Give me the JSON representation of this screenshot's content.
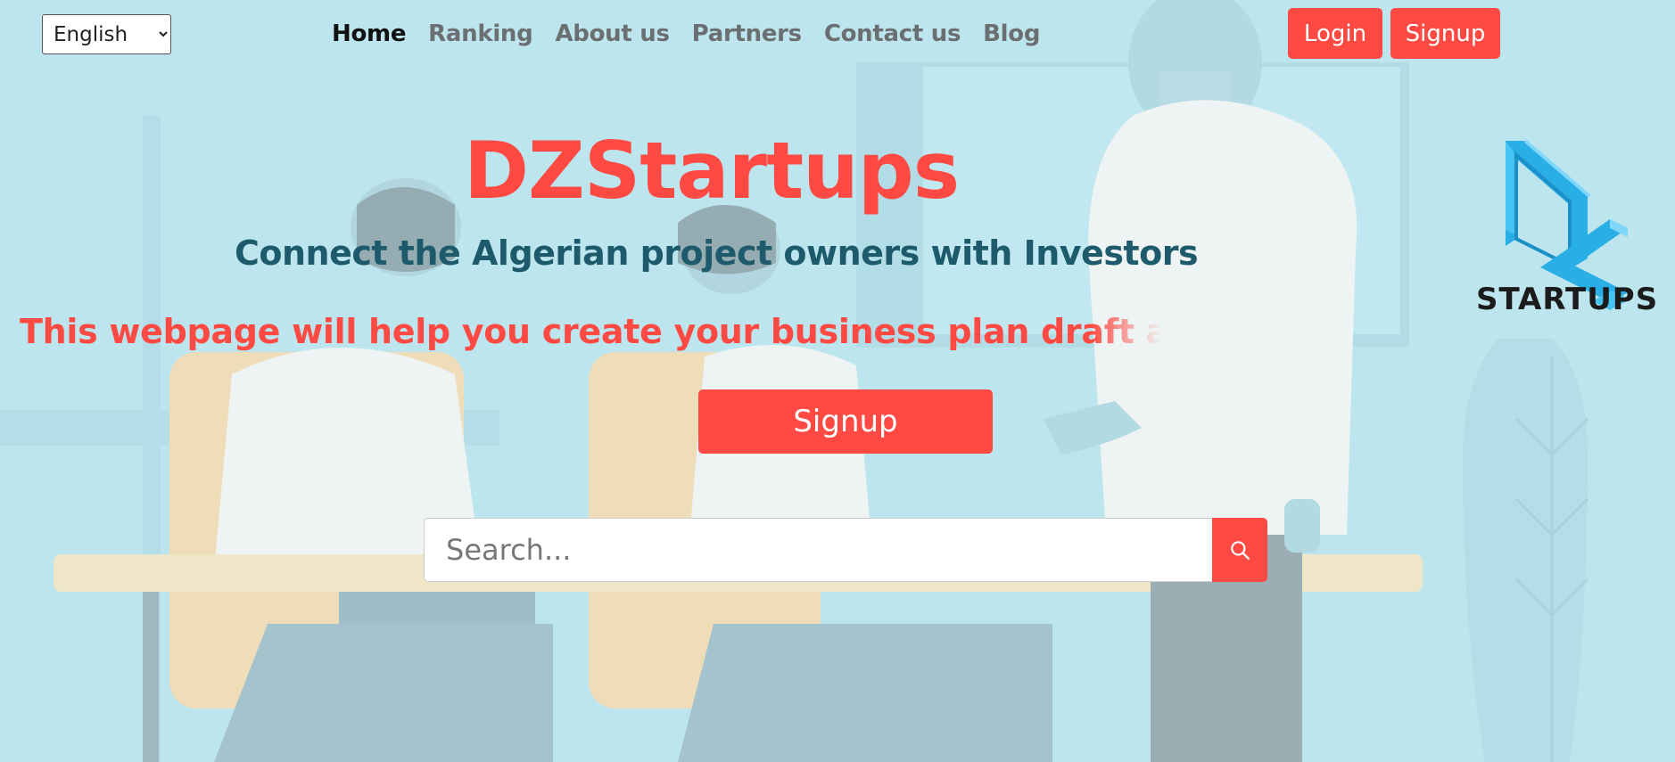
{
  "header": {
    "language": {
      "selected": "English",
      "options": [
        "English"
      ]
    },
    "nav": [
      {
        "label": "Home",
        "active": true
      },
      {
        "label": "Ranking",
        "active": false
      },
      {
        "label": "About us",
        "active": false
      },
      {
        "label": "Partners",
        "active": false
      },
      {
        "label": "Contact us",
        "active": false
      },
      {
        "label": "Blog",
        "active": false
      }
    ],
    "login_label": "Login",
    "signup_label": "Signup"
  },
  "hero": {
    "title": "DZStartups",
    "subtitle": "Connect the Algerian project owners with Investors",
    "marquee_text": "This webpage will help you create your business plan draft afte",
    "signup_label": "Signup",
    "search": {
      "placeholder": "Search...",
      "value": ""
    }
  },
  "logo": {
    "text": "STARTUPS"
  },
  "colors": {
    "accent": "#fe4a43",
    "subtitle": "#1d5a6b",
    "background": "#bde5ee",
    "logo_blue": "#2aaee6"
  },
  "icons": {
    "search": "search-icon",
    "logo": "dz-logo-icon",
    "language_dropdown": "chevron-down-icon"
  }
}
